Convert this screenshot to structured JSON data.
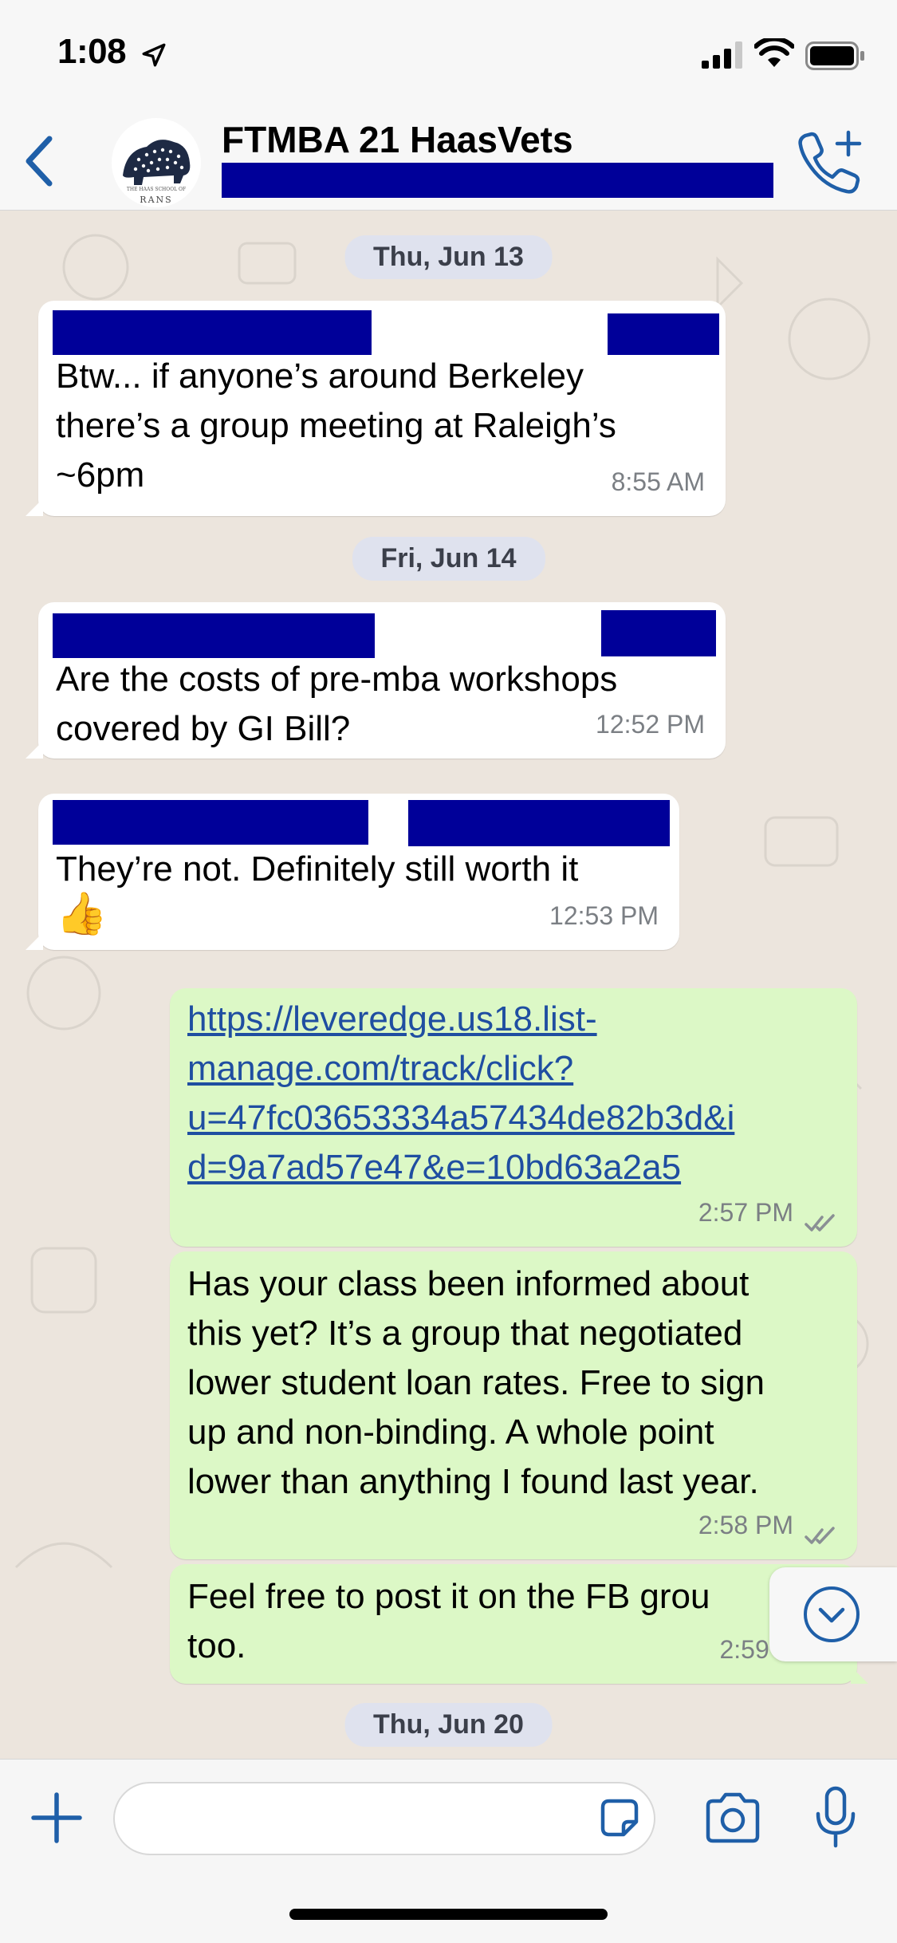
{
  "status_bar": {
    "time": "1:08"
  },
  "header": {
    "title": "FTMBA 21 HaasVets",
    "subtitle": "",
    "avatar_text_top": "THE HAAS SCHOOL OF",
    "avatar_text_bottom": "RANS"
  },
  "messages": [
    {
      "date": "Thu, Jun 13"
    },
    {
      "direction": "in",
      "text_lines": [
        "Btw... if anyone’s around Berkeley",
        "there’s a group meeting at Raleigh’s",
        "~6pm"
      ],
      "time": "8:55 AM"
    },
    {
      "date": "Fri, Jun 14"
    },
    {
      "direction": "in",
      "text_lines": [
        "Are the costs of pre-mba workshops",
        "covered by GI Bill?"
      ],
      "time": "12:52 PM"
    },
    {
      "direction": "in",
      "text_lines": [
        "They’re not. Definitely still worth it"
      ],
      "emoji": "👍",
      "time": "12:53 PM"
    },
    {
      "direction": "out",
      "link_lines": [
        "https://leveredge.us18.list-",
        "manage.com/track/click?",
        "u=47fc03653334a57434de82b3d&i",
        "d=9a7ad57e47&e=10bd63a2a5"
      ],
      "time": "2:57 PM"
    },
    {
      "direction": "out",
      "text_lines": [
        "Has your class been informed about",
        "this yet? It’s a group that negotiated",
        "lower student loan rates. Free to sign",
        "up and non-binding. A whole point",
        "lower than anything I found last year."
      ],
      "time": "2:58 PM"
    },
    {
      "direction": "out",
      "text_lines": [
        "Feel free to post it on the FB grou",
        "too."
      ],
      "time": "2:59 P"
    },
    {
      "date": "Thu, Jun 20"
    }
  ],
  "input": {
    "placeholder": ""
  },
  "colors": {
    "accent": "#1f5fa8",
    "incoming_bubble": "#ffffff",
    "outgoing_bubble": "#dcf8c6",
    "chat_background": "#ece5dd",
    "redaction": "#000099"
  },
  "icons": {
    "back": "chevron-left-icon",
    "call": "phone-plus-icon",
    "plus": "plus-icon",
    "sticker": "sticker-icon",
    "camera": "camera-icon",
    "mic": "microphone-icon",
    "scroll": "chevron-down-circle-icon",
    "ticks": "double-check-icon"
  }
}
